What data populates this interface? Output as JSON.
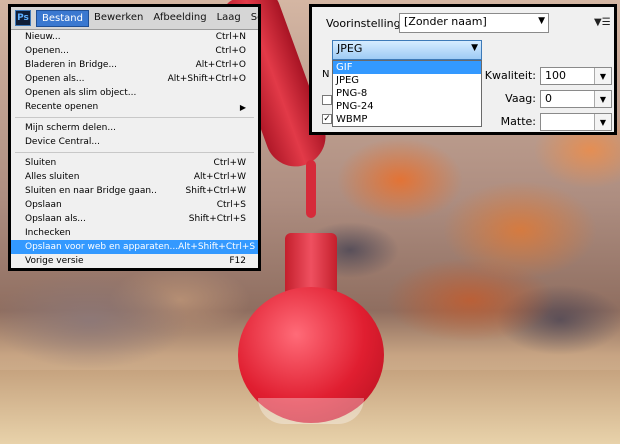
{
  "menubar": {
    "logo": "Ps",
    "items": [
      "Bestand",
      "Bewerken",
      "Afbeelding",
      "Laag",
      "Selecteren"
    ],
    "active_index": 0
  },
  "file_menu": {
    "items": [
      {
        "label": "Nieuw...",
        "shortcut": "Ctrl+N"
      },
      {
        "label": "Openen...",
        "shortcut": "Ctrl+O"
      },
      {
        "label": "Bladeren in Bridge...",
        "shortcut": "Alt+Ctrl+O"
      },
      {
        "label": "Openen als...",
        "shortcut": "Alt+Shift+Ctrl+O"
      },
      {
        "label": "Openen als slim object...",
        "shortcut": ""
      },
      {
        "label": "Recente openen",
        "shortcut": "",
        "submenu": true
      },
      {
        "separator": true
      },
      {
        "label": "Mijn scherm delen...",
        "shortcut": ""
      },
      {
        "label": "Device Central...",
        "shortcut": ""
      },
      {
        "separator": true
      },
      {
        "label": "Sluiten",
        "shortcut": "Ctrl+W"
      },
      {
        "label": "Alles sluiten",
        "shortcut": "Alt+Ctrl+W"
      },
      {
        "label": "Sluiten en naar Bridge gaan..",
        "shortcut": "Shift+Ctrl+W"
      },
      {
        "label": "Opslaan",
        "shortcut": "Ctrl+S"
      },
      {
        "label": "Opslaan als...",
        "shortcut": "Shift+Ctrl+S"
      },
      {
        "label": "Inchecken",
        "shortcut": ""
      },
      {
        "label": "Opslaan voor web en apparaten...",
        "shortcut": "Alt+Shift+Ctrl+S",
        "highlighted": true
      },
      {
        "label": "Vorige versie",
        "shortcut": "F12"
      }
    ]
  },
  "save_for_web": {
    "preset_label": "Voorinstelling:",
    "preset_value": "[Zonder naam]",
    "format_value": "JPEG",
    "format_options": [
      "GIF",
      "JPEG",
      "PNG-8",
      "PNG-24",
      "WBMP"
    ],
    "selected_option_index": 0,
    "quality_label": "Kwaliteit:",
    "quality_value": "100",
    "blur_label": "Vaag:",
    "blur_value": "0",
    "matte_label": "Matte:",
    "matte_value": ""
  },
  "colors": {
    "menu_highlight": "#3399ff",
    "menubar_active": "#3a78d0",
    "format_combo": "#9ecbf5"
  }
}
